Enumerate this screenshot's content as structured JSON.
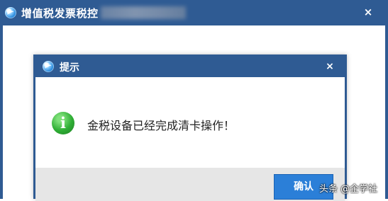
{
  "outer_window": {
    "title": "增值税发票税控",
    "close_glyph": "×"
  },
  "dialog": {
    "title": "提示",
    "close_glyph": "×",
    "message": "金税设备已经完成清卡操作！",
    "info_glyph": "i",
    "ok_label": "确认"
  },
  "watermark": "头条 @企学社",
  "colors": {
    "titlebar": "#2f5b93",
    "button": "#2b7fd8",
    "info_green": "#2fae35",
    "button_bar": "#e6e6e6"
  },
  "icons": [
    "app-icon",
    "close-icon",
    "info-icon"
  ]
}
